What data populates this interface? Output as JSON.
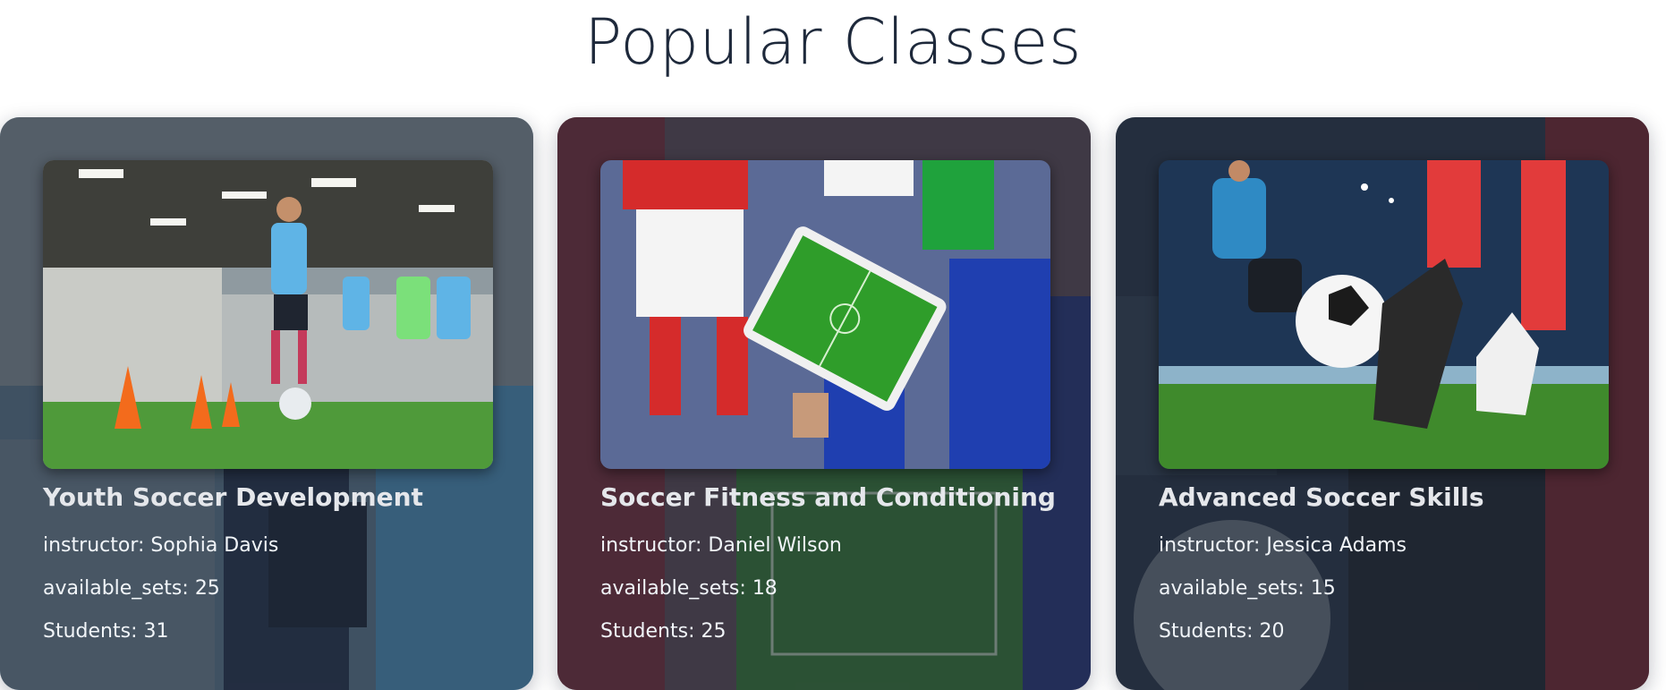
{
  "section": {
    "title": "Popular Classes"
  },
  "cards": [
    {
      "title": "Youth Soccer Development",
      "instructor_label": "instructor:",
      "instructor": "Sophia Davis",
      "sets_label": "available_sets:",
      "available_sets": "25",
      "students_label": "Students:",
      "students": "31"
    },
    {
      "title": "Soccer Fitness and Conditioning",
      "instructor_label": "instructor:",
      "instructor": "Daniel Wilson",
      "sets_label": "available_sets:",
      "available_sets": "18",
      "students_label": "Students:",
      "students": "25"
    },
    {
      "title": "Advanced Soccer Skills",
      "instructor_label": "instructor:",
      "instructor": "Jessica Adams",
      "sets_label": "available_sets:",
      "available_sets": "15",
      "students_label": "Students:",
      "students": "20"
    }
  ],
  "colors": {
    "title_text": "#1e293b",
    "card_overlay": "#1c2230",
    "card_text": "#f1f5f9"
  }
}
